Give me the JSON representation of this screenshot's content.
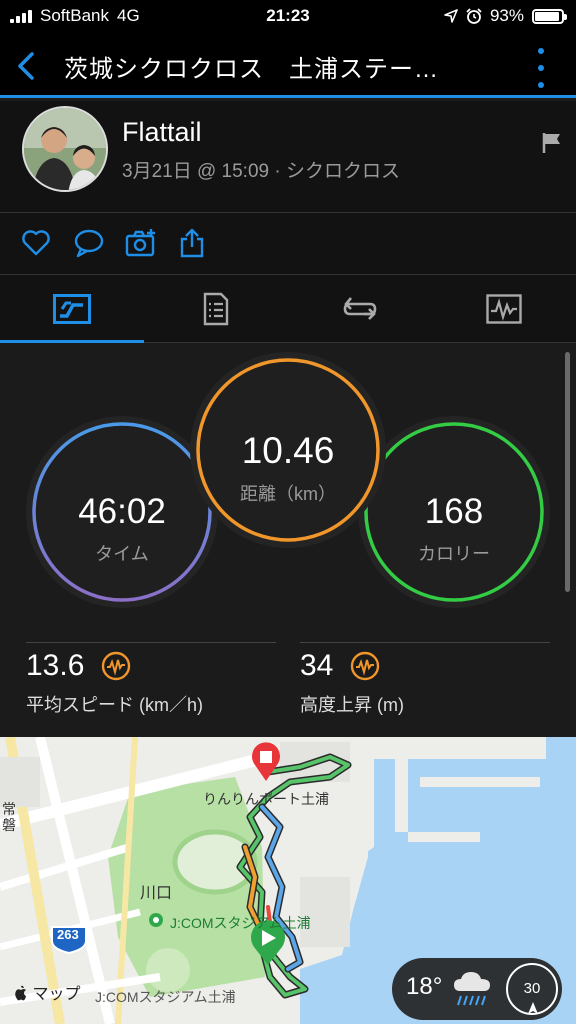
{
  "status_bar": {
    "carrier": "SoftBank",
    "network": "4G",
    "time": "21:23",
    "battery": "93%",
    "battery_level": 0.93
  },
  "nav": {
    "title": "茨城シクロクロス　土浦ステー…",
    "back_icon": "chevron-left-icon",
    "more_icon": "more-vertical-icon"
  },
  "profile": {
    "name": "Flattail",
    "subtitle": "3月21日 @ 15:09 · シクロクロス"
  },
  "actions": [
    "heart-icon",
    "comment-icon",
    "add-photo-icon",
    "share-icon"
  ],
  "tabs": [
    {
      "icon": "summary-icon",
      "active": true
    },
    {
      "icon": "details-icon",
      "active": false
    },
    {
      "icon": "laps-icon",
      "active": false
    },
    {
      "icon": "graph-icon",
      "active": false
    }
  ],
  "stats": {
    "time": {
      "value": "46:02",
      "label": "タイム"
    },
    "distance": {
      "value": "10.46",
      "label": "距離（km）"
    },
    "calories": {
      "value": "168",
      "label": "カロリー"
    },
    "avg_speed": {
      "value": "13.6",
      "label": "平均スピード (km／h)"
    },
    "elevation_gain": {
      "value": "34",
      "label": "高度上昇 (m)"
    }
  },
  "map": {
    "labels": {
      "poi_top": "りんりんポート土浦",
      "kawaguchi": "川口",
      "stadium": "J:COMスタジアム土浦",
      "stadium_bottom": "J:COMスタジアム土浦",
      "road_number": "263",
      "road_name": "常磐"
    },
    "attribution": "マップ",
    "weather": {
      "temp": "18°",
      "wind": "30"
    }
  },
  "colors": {
    "accent": "#1f8ee6",
    "time_ring": "#5b8fd6",
    "distance_ring": "#f0962a",
    "calories_ring": "#33cc44",
    "icon_orange": "#f0962a"
  }
}
